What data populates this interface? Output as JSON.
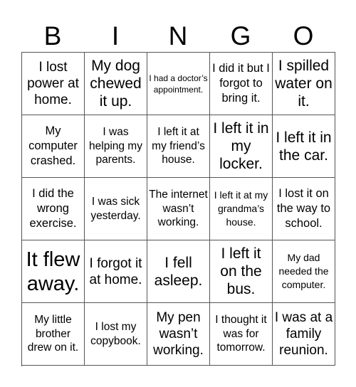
{
  "header": {
    "letters": [
      "B",
      "I",
      "N",
      "G",
      "O"
    ]
  },
  "cells": [
    {
      "text": "I lost power at home.",
      "size": "s-m"
    },
    {
      "text": "My dog chewed it up.",
      "size": "s-l"
    },
    {
      "text": "I had a doctor’s appointment.",
      "size": "s-xxs"
    },
    {
      "text": "I did it but I forgot to bring it.",
      "size": "s-sm"
    },
    {
      "text": "I spilled water on it.",
      "size": "s-l"
    },
    {
      "text": "My computer crashed.",
      "size": "s-sm"
    },
    {
      "text": "I was helping my parents.",
      "size": "s-s"
    },
    {
      "text": "I left it at my friend’s house.",
      "size": "s-s"
    },
    {
      "text": "I left it in my locker.",
      "size": "s-l"
    },
    {
      "text": "I left it in the car.",
      "size": "s-l"
    },
    {
      "text": "I did the wrong exercise.",
      "size": "s-sm"
    },
    {
      "text": "I was sick yesterday.",
      "size": "s-s"
    },
    {
      "text": "The internet wasn’t working.",
      "size": "s-s"
    },
    {
      "text": "I left it at my grandma’s house.",
      "size": "s-xs"
    },
    {
      "text": "I lost it on the way to school.",
      "size": "s-sm"
    },
    {
      "text": "It flew away.",
      "size": "s-xl"
    },
    {
      "text": "I forgot it at home.",
      "size": "s-m"
    },
    {
      "text": "I fell asleep.",
      "size": "s-l"
    },
    {
      "text": "I left it on the bus.",
      "size": "s-l"
    },
    {
      "text": "My dad needed the computer.",
      "size": "s-xs"
    },
    {
      "text": "My little brother drew on it.",
      "size": "s-s"
    },
    {
      "text": "I lost my copybook.",
      "size": "s-s"
    },
    {
      "text": "My pen wasn’t working.",
      "size": "s-m"
    },
    {
      "text": "I thought it was for tomorrow.",
      "size": "s-s"
    },
    {
      "text": "I was at a family reunion.",
      "size": "s-m"
    }
  ]
}
